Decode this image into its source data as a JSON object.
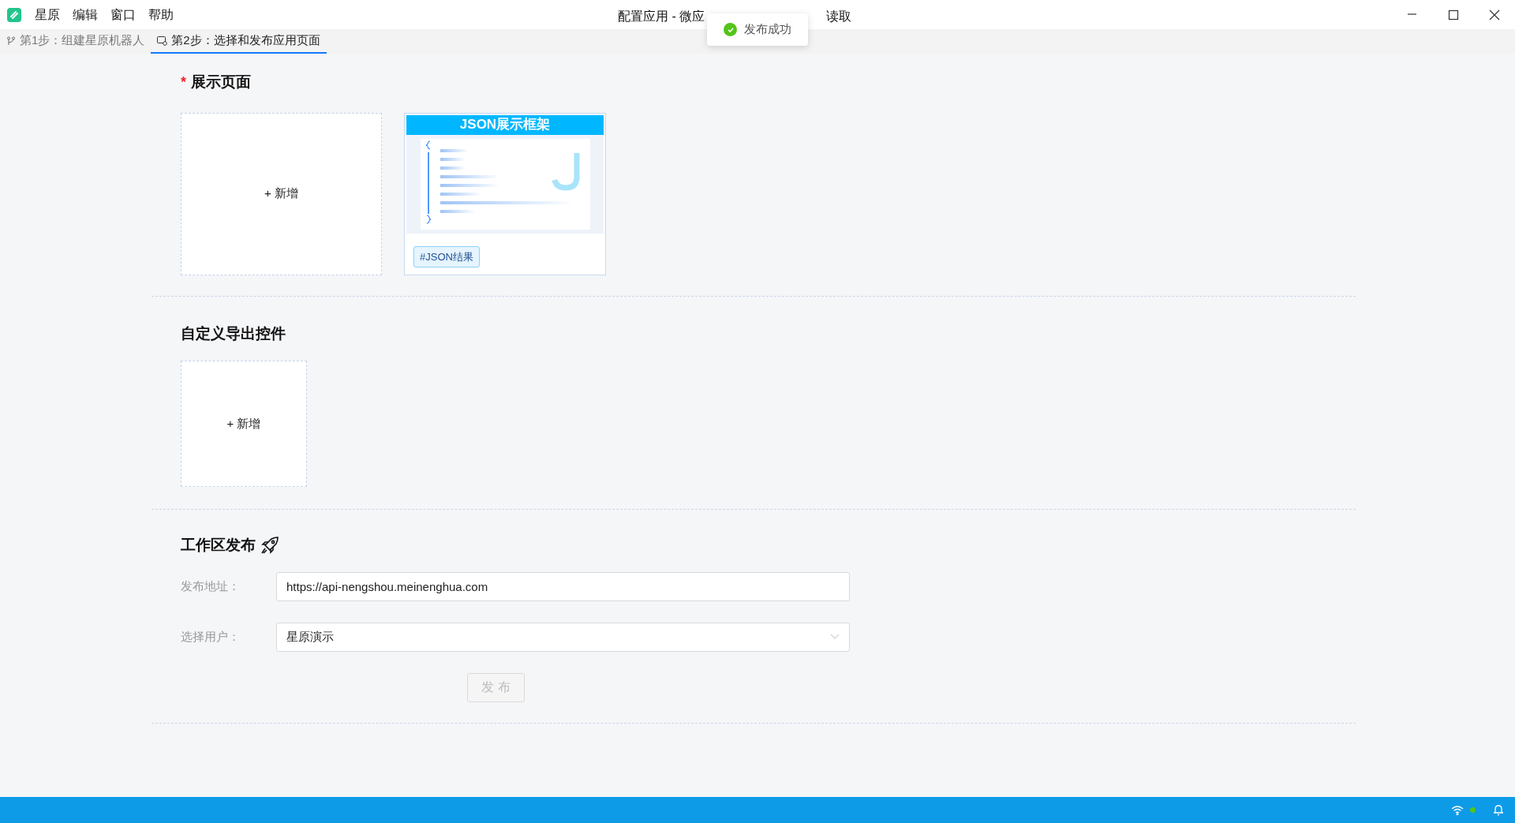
{
  "menu": [
    "星原",
    "编辑",
    "窗口",
    "帮助"
  ],
  "title_parts": [
    "配置应用 - 微应",
    "读取"
  ],
  "toast": {
    "text": "发布成功"
  },
  "tabs": [
    {
      "label": "第1步：组建星原机器人",
      "selected": false,
      "kind": "branch"
    },
    {
      "label": "第2步：选择和发布应用页面",
      "selected": true,
      "kind": "page"
    }
  ],
  "display_page": {
    "required_mark": "*",
    "title": "展示页面",
    "add_label": "+ 新增",
    "templates": [
      {
        "banner": "JSON展示框架",
        "tag": "#JSON结果"
      }
    ]
  },
  "custom_controls": {
    "title": "自定义导出控件",
    "add_label": "+ 新增"
  },
  "publish": {
    "title": "工作区发布",
    "fields": [
      {
        "kind": "input",
        "label": "发布地址：",
        "value": "https://api-nengshou.meinenghua.com"
      },
      {
        "kind": "select",
        "label": "选择用户：",
        "value": "星原演示"
      }
    ],
    "button": {
      "label": "发 布",
      "disabled": true
    }
  }
}
